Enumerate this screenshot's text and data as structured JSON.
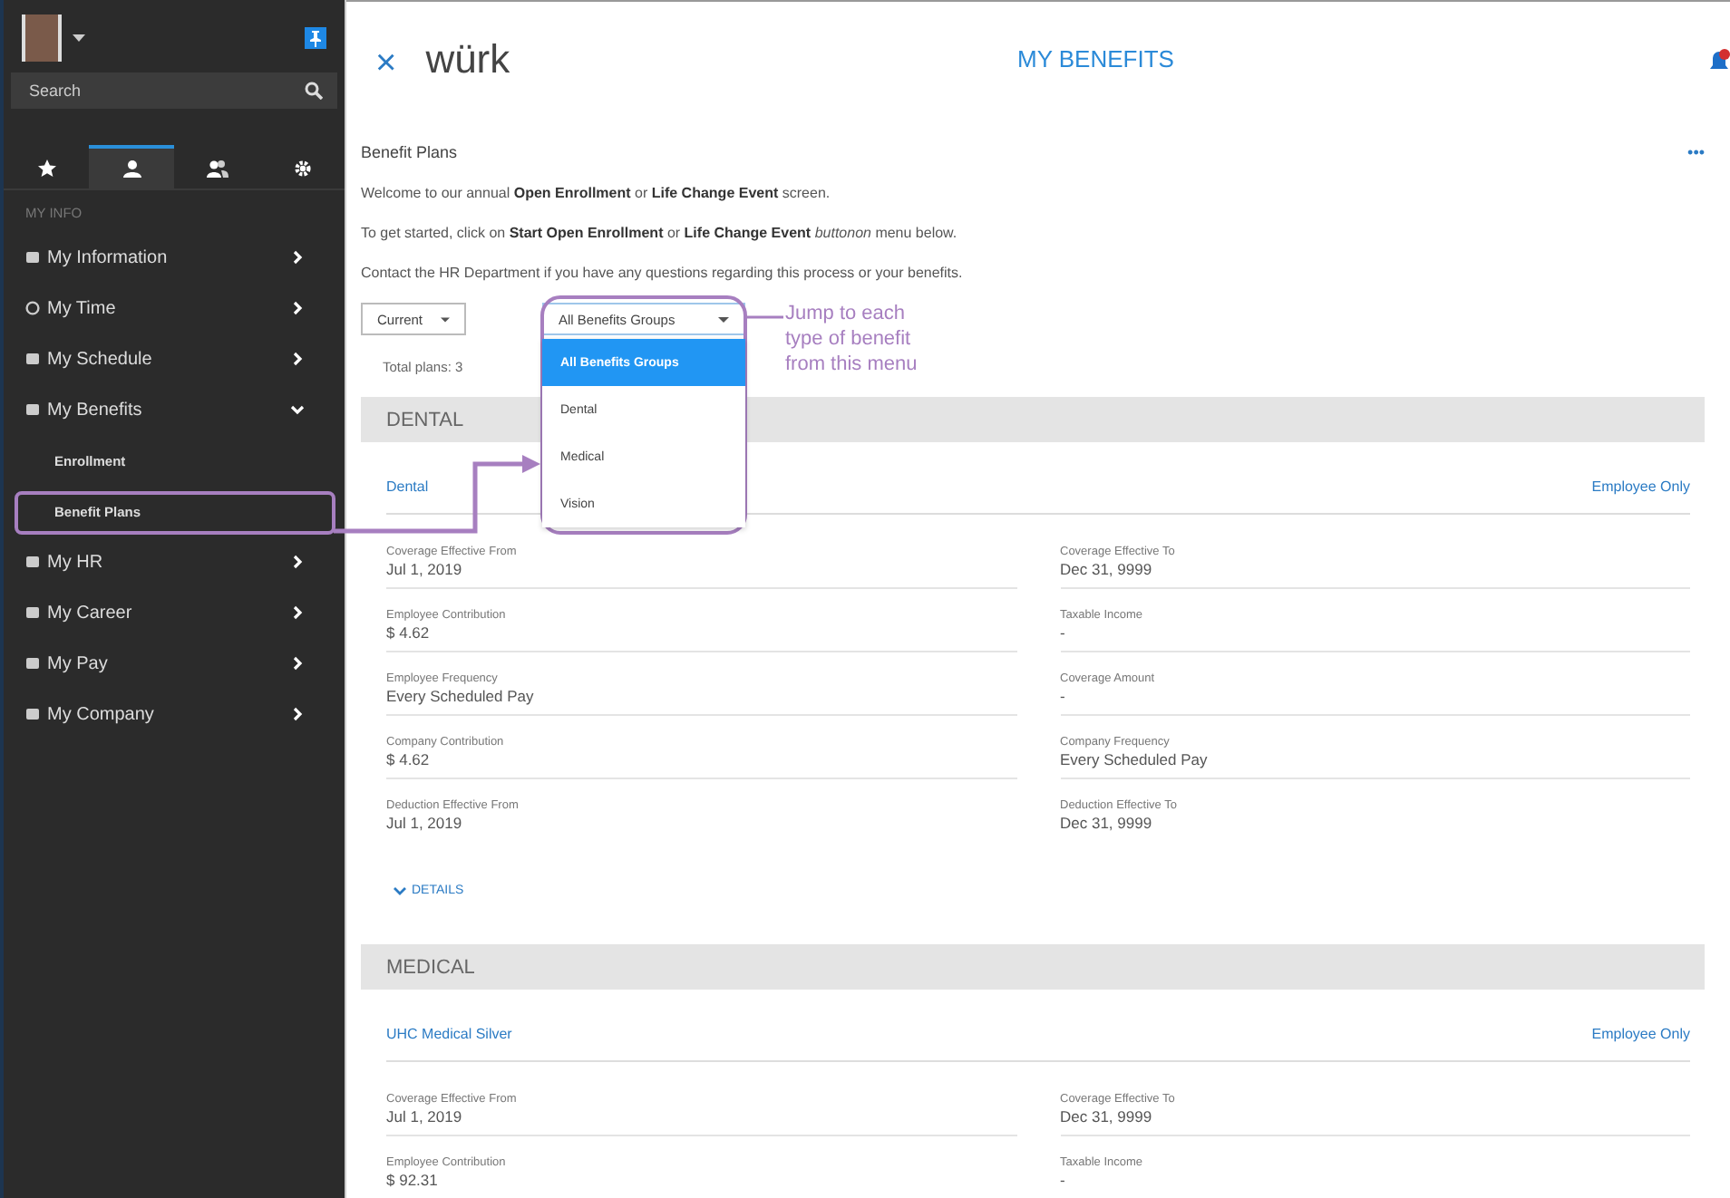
{
  "sidebar": {
    "search": {
      "placeholder": "Search"
    },
    "tabs": [
      {
        "kind": "favorites",
        "selected": false
      },
      {
        "kind": "person",
        "selected": true
      },
      {
        "kind": "team",
        "selected": false
      },
      {
        "kind": "settings",
        "selected": false
      }
    ],
    "section_label": "MY INFO",
    "items": [
      {
        "label": "My Information",
        "expanded": false
      },
      {
        "label": "My Time",
        "expanded": false
      },
      {
        "label": "My Schedule",
        "expanded": false
      },
      {
        "label": "My Benefits",
        "expanded": true,
        "children": [
          {
            "label": "Enrollment"
          },
          {
            "label": "Benefit Plans"
          }
        ]
      },
      {
        "label": "My HR",
        "expanded": false
      },
      {
        "label": "My Career",
        "expanded": false
      },
      {
        "label": "My Pay",
        "expanded": false
      },
      {
        "label": "My Company",
        "expanded": false
      }
    ]
  },
  "header": {
    "close": "×",
    "logo": "würk",
    "title": "MY BENEFITS"
  },
  "page": {
    "title": "Benefit Plans",
    "more": "•••",
    "intro": [
      "Welcome to our annual **Open Enrollment** or **Life Change Event** screen.",
      "To get started, click on **Start Open Enrollment** or **Life Change Event** *buttonon* menu below.",
      "Contact the HR Department if you have any questions regarding this process or your benefits."
    ],
    "period_select": {
      "value": "Current"
    },
    "group_select": {
      "value": "All Benefits Groups",
      "expanded": true,
      "options": [
        {
          "label": "All Benefits Groups",
          "selected": true
        },
        {
          "label": "Dental",
          "selected": false
        },
        {
          "label": "Medical",
          "selected": false
        },
        {
          "label": "Vision",
          "selected": false
        }
      ]
    },
    "total": "Total plans: 3",
    "sections": [
      {
        "heading": "DENTAL",
        "plan": "Dental",
        "coverage": "Employee Only",
        "fields": [
          {
            "label": "Coverage Effective From",
            "value": "Jul 1, 2019"
          },
          {
            "label": "Coverage Effective To",
            "value": "Dec 31, 9999"
          },
          {
            "label": "Employee Contribution",
            "value": "$ 4.62"
          },
          {
            "label": "Taxable Income",
            "value": "-"
          },
          {
            "label": "Employee Frequency",
            "value": "Every Scheduled Pay"
          },
          {
            "label": "Coverage Amount",
            "value": "-"
          },
          {
            "label": "Company Contribution",
            "value": "$ 4.62"
          },
          {
            "label": "Company Frequency",
            "value": "Every Scheduled Pay"
          },
          {
            "label": "Deduction Effective From",
            "value": "Jul 1, 2019"
          },
          {
            "label": "Deduction Effective To",
            "value": "Dec 31, 9999"
          }
        ],
        "details": "DETAILS"
      },
      {
        "heading": "MEDICAL",
        "plan": "UHC Medical Silver",
        "coverage": "Employee Only",
        "fields": [
          {
            "label": "Coverage Effective From",
            "value": "Jul 1, 2019"
          },
          {
            "label": "Coverage Effective To",
            "value": "Dec 31, 9999"
          },
          {
            "label": "Employee Contribution",
            "value": "$ 92.31"
          },
          {
            "label": "Taxable Income",
            "value": "-"
          }
        ]
      }
    ]
  },
  "annotation": {
    "lines": [
      "Jump to each",
      "type of benefit",
      "from this menu"
    ]
  }
}
